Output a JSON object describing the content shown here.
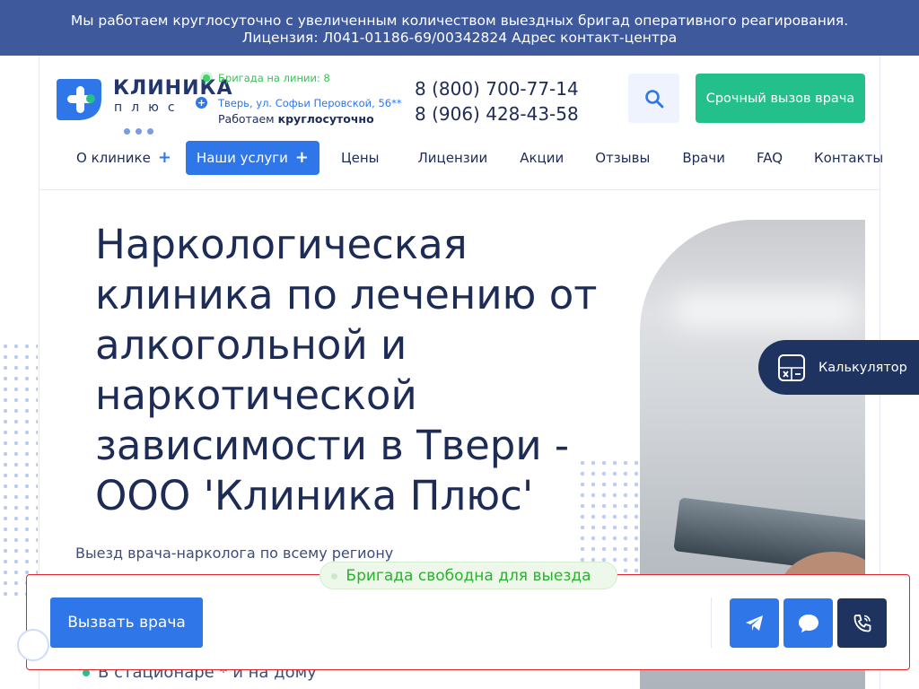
{
  "topbar": {
    "line1": "Мы работаем круглосуточно с увеличенным количеством выездных бригад оперативного реагирования.",
    "line2": "Лицензия: Л041-01186-69/00342824 Адрес контакт-центра"
  },
  "logo": {
    "name": "КЛИНИКА",
    "sub": "плюс"
  },
  "info": {
    "brigade": "Бригада на линии: 8",
    "address": "Тверь, ул. Софьи Перовской, 56**",
    "work_prefix": "Работаем",
    "work_bold": "круглосуточно"
  },
  "phones": [
    "8 (800) 700-77-14",
    "8 (906) 428-43-58"
  ],
  "urgent_button": "Срочный вызов врача",
  "nav": [
    {
      "label": "О клинике",
      "plus": true,
      "active": false
    },
    {
      "label": "Наши услуги",
      "plus": true,
      "active": true
    },
    {
      "label": "Цены"
    },
    {
      "label": "Лицензии"
    },
    {
      "label": "Акции"
    },
    {
      "label": "Отзывы"
    },
    {
      "label": "Врачи"
    },
    {
      "label": "FAQ"
    },
    {
      "label": "Контакты"
    }
  ],
  "hero": {
    "title": "Наркологическая клиника по лечению от алкогольной и наркотической зависимости в Твери - ООО 'Клиника Плюс'",
    "subtitle": "Выезд врача-нарколога по всему региону",
    "bullet": "В стационаре * и на дому"
  },
  "calculator": "Калькулятор",
  "status_pill": "Бригада свободна для выезда",
  "call_button": "Вызвать врача",
  "colors": {
    "accent": "#2f76e8",
    "navy": "#1f3360",
    "green": "#24c08c",
    "topbar": "#3e5a9c"
  }
}
